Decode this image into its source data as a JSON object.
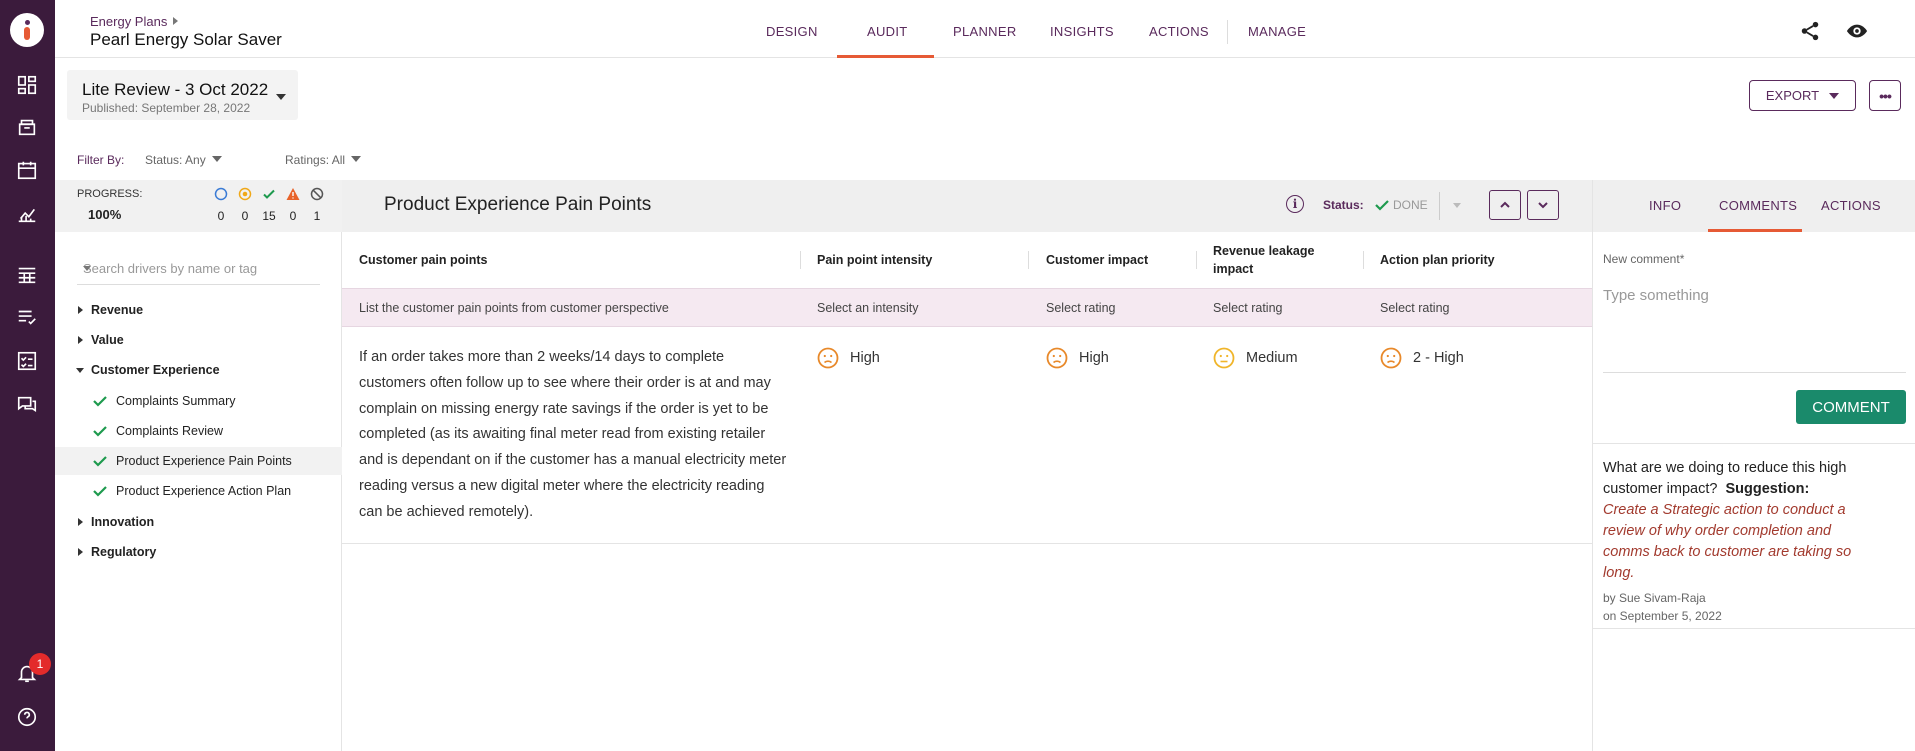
{
  "header": {
    "breadcrumb": "Energy Plans",
    "plan_title": "Pearl Energy Solar Saver",
    "nav": [
      {
        "label": "DESIGN"
      },
      {
        "label": "AUDIT"
      },
      {
        "label": "PLANNER"
      },
      {
        "label": "INSIGHTS"
      },
      {
        "label": "ACTIONS"
      },
      {
        "label": "MANAGE"
      }
    ],
    "active_nav": "AUDIT",
    "icons": [
      "share-icon",
      "eye-icon"
    ]
  },
  "rail": {
    "icons": [
      "logo",
      "dashboard-icon",
      "inbox-icon",
      "calendar-icon",
      "chart-icon",
      "table-icon",
      "checklist-icon",
      "task-icon",
      "chat-icon",
      "bell-icon",
      "help-icon"
    ],
    "notification_count": "1"
  },
  "review": {
    "title": "Lite Review - 3 Oct 2022",
    "published": "Published: September 28, 2022"
  },
  "toolbar": {
    "export_label": "EXPORT",
    "more_label": "•••"
  },
  "filters": {
    "label": "Filter By:",
    "status": "Status: Any",
    "ratings": "Ratings: All"
  },
  "progress": {
    "label": "PROGRESS:",
    "value": "100%",
    "counts": [
      "0",
      "0",
      "15",
      "0",
      "1"
    ],
    "icons": [
      "not-started-icon",
      "in-progress-icon",
      "done-check-icon",
      "warning-icon",
      "blocked-icon"
    ]
  },
  "sidebar": {
    "search_placeholder": "Search drivers by name or tag",
    "groups": [
      {
        "label": "Revenue",
        "expanded": false
      },
      {
        "label": "Value",
        "expanded": false
      },
      {
        "label": "Customer Experience",
        "expanded": true,
        "items": [
          {
            "label": "Complaints Summary"
          },
          {
            "label": "Complaints Review"
          },
          {
            "label": "Product Experience Pain Points"
          },
          {
            "label": "Product Experience Action Plan"
          }
        ]
      },
      {
        "label": "Innovation",
        "expanded": false
      },
      {
        "label": "Regulatory",
        "expanded": false
      }
    ],
    "active_item": "Product Experience Pain Points"
  },
  "main": {
    "title": "Product Experience Pain Points",
    "status_label": "Status:",
    "status_value": "DONE",
    "colors": {
      "brand": "#5a2a5c",
      "accent": "#e65a35",
      "success": "#1a8a6b"
    },
    "columns": [
      "Customer pain points",
      "Pain point intensity",
      "Customer impact",
      "Revenue leakage impact",
      "Action plan priority"
    ],
    "hints": [
      "List the customer pain points from customer perspective",
      "Select an intensity",
      "Select rating",
      "Select rating",
      "Select rating"
    ],
    "row": {
      "pain_point": "If an order takes more than 2 weeks/14 days to complete customers often follow up to see where their order is at and may complain on missing energy rate savings if the order is yet to be completed (as its awaiting final meter read from existing retailer and is dependant on if the customer has a manual electricity meter reading versus a new digital meter where the electricity reading can be achieved remotely).",
      "intensity": "High",
      "customer_impact": "High",
      "revenue_leakage": "Medium",
      "priority": "2 - High"
    }
  },
  "right_panel": {
    "tabs": [
      "INFO",
      "COMMENTS",
      "ACTIONS"
    ],
    "active_tab": "COMMENTS",
    "new_comment_label": "New comment*",
    "new_comment_placeholder": "Type something",
    "comment_button": "COMMENT",
    "comment": {
      "question": "What are we doing to reduce this high customer impact?",
      "suggestion_label": "Suggestion:",
      "suggestion": "Create a Strategic action to conduct a review of why order completion and comms back to customer are taking so long.",
      "author": "by Sue Sivam-Raja",
      "date": "on September 5, 2022"
    }
  }
}
